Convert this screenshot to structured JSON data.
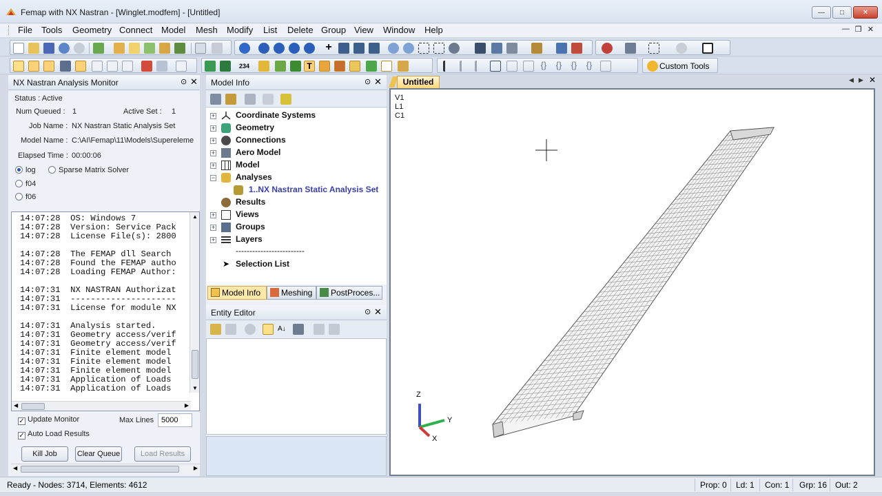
{
  "window": {
    "title": "Femap with NX Nastran - [Winglet.modfem] - [Untitled]"
  },
  "menu": [
    "File",
    "Tools",
    "Geometry",
    "Connect",
    "Model",
    "Mesh",
    "Modify",
    "List",
    "Delete",
    "Group",
    "View",
    "Window",
    "Help"
  ],
  "toolbar": {
    "custom_tools_label": "Custom Tools"
  },
  "monitor": {
    "title": "NX Nastran Analysis Monitor",
    "status": "Status : Active",
    "num_queued_label": "Num Queued  :",
    "num_queued": "1",
    "active_set_label": "Active Set :",
    "active_set": "1",
    "job_name_label": "Job Name :",
    "job_name": "NX Nastran Static Analysis Set",
    "model_name_label": "Model Name :",
    "model_name": "C:\\AI\\Femap\\11\\Models\\Supereleme",
    "elapsed_label": "Elapsed Time :",
    "elapsed": "00:00:06",
    "radio_log": "log",
    "radio_f04": "f04",
    "radio_f06": "f06",
    "sparse_label": "Sparse Matrix Solver",
    "log_lines": [
      "14:07:28  OS: Windows 7",
      "14:07:28  Version: Service Pack",
      "14:07:28  License File(s): 2800",
      "",
      "14:07:28  The FEMAP dll Search",
      "14:07:28  Found the FEMAP autho",
      "14:07:28  Loading FEMAP Author:",
      "",
      "14:07:31  NX NASTRAN Authorizat",
      "14:07:31  ---------------------",
      "14:07:31  License for module NX",
      "",
      "14:07:31  Analysis started.",
      "14:07:31  Geometry access/verif",
      "14:07:31  Geometry access/verif",
      "14:07:31  Finite element model",
      "14:07:31  Finite element model",
      "14:07:31  Finite element model",
      "14:07:31  Application of Loads",
      "14:07:31  Application of Loads"
    ],
    "update_monitor": "Update Monitor",
    "auto_load": "Auto Load Results",
    "max_lines_label": "Max Lines",
    "max_lines": "5000",
    "kill_job": "Kill Job",
    "clear_queue": "Clear Queue",
    "load_results": "Load Results"
  },
  "model_info": {
    "title": "Model Info",
    "items": [
      {
        "label": "Coordinate Systems",
        "icon": "coord-icon"
      },
      {
        "label": "Geometry",
        "icon": "geometry-icon"
      },
      {
        "label": "Connections",
        "icon": "connections-icon"
      },
      {
        "label": "Aero Model",
        "icon": "aero-icon"
      },
      {
        "label": "Model",
        "icon": "model-icon"
      },
      {
        "label": "Analyses",
        "icon": "analyses-icon"
      },
      {
        "label": "1..NX Nastran Static Analysis Set",
        "icon": "analysis-set-icon"
      },
      {
        "label": "Results",
        "icon": "results-icon"
      },
      {
        "label": "Views",
        "icon": "views-icon"
      },
      {
        "label": "Groups",
        "icon": "groups-icon"
      },
      {
        "label": "Layers",
        "icon": "layers-icon"
      },
      {
        "label": "-------------------------",
        "icon": ""
      },
      {
        "label": "Selection List",
        "icon": "selection-icon"
      }
    ],
    "tabs": [
      "Model Info",
      "Meshing",
      "PostProces..."
    ]
  },
  "entity_editor": {
    "title": "Entity Editor"
  },
  "viewport": {
    "tab": "Untitled",
    "labels": [
      "V1",
      "L1",
      "C1"
    ],
    "axis_z": "Z",
    "axis_y": "Y",
    "axis_x": "X",
    "colors": {
      "z_axis": "#3a4fd6",
      "y_axis": "#2fb04a",
      "x_axis": "#d23a3a"
    }
  },
  "status": {
    "left": "Ready - Nodes: 3714,  Elements: 4612",
    "prop": "Prop: 0",
    "ld": "Ld: 1",
    "con": "Con: 1",
    "grp": "Grp: 16",
    "out": "Out: 2"
  }
}
